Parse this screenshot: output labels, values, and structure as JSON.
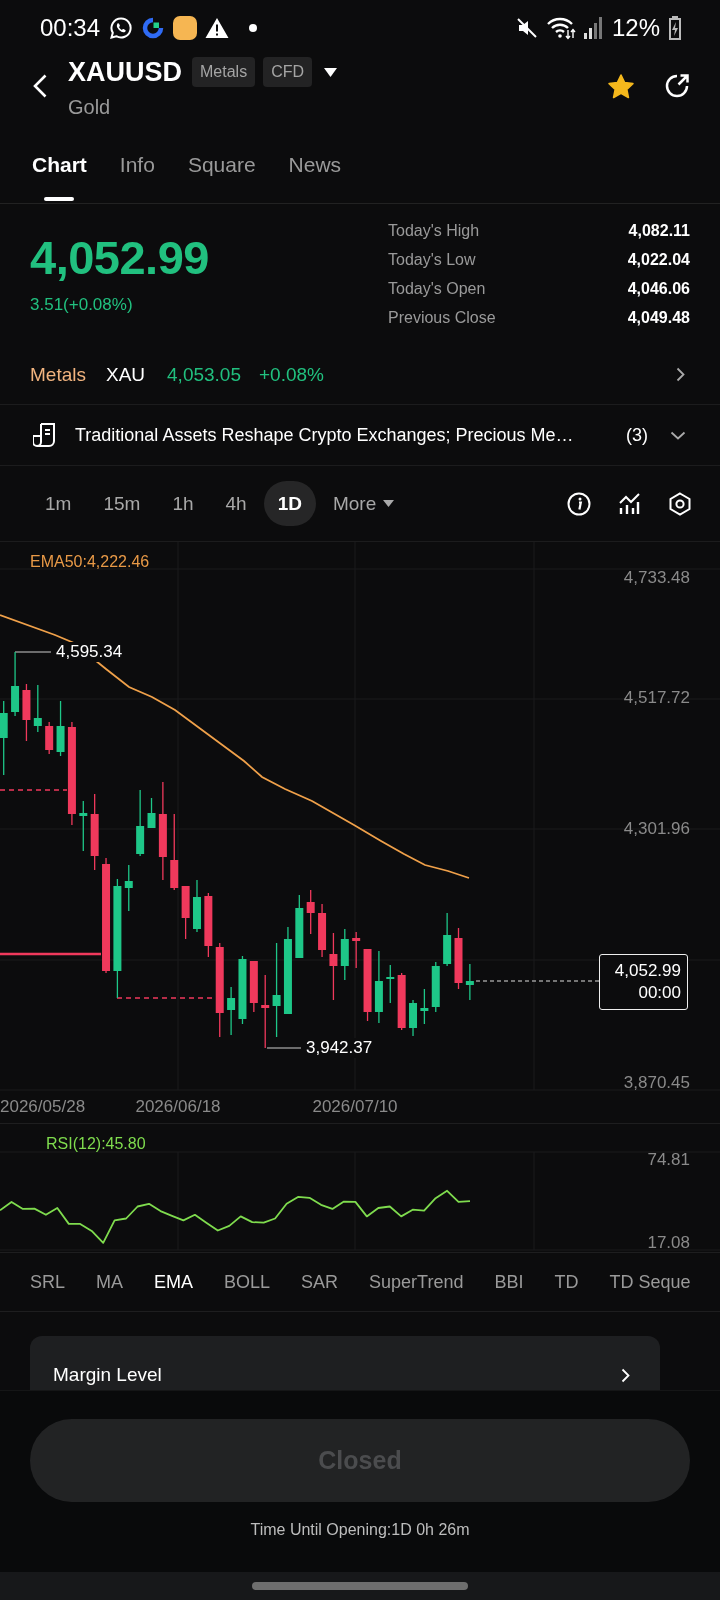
{
  "status_bar": {
    "time": "00:34",
    "battery": "12%"
  },
  "header": {
    "symbol": "XAUUSD",
    "badges": [
      "Metals",
      "CFD"
    ],
    "name": "Gold",
    "favorite": true
  },
  "tabs": [
    {
      "label": "Chart",
      "selected": true
    },
    {
      "label": "Info",
      "selected": false
    },
    {
      "label": "Square",
      "selected": false
    },
    {
      "label": "News",
      "selected": false
    }
  ],
  "quote": {
    "price": "4,052.99",
    "change": "3.51(+0.08%)",
    "stats": [
      {
        "label": "Today's High",
        "value": "4,082.11"
      },
      {
        "label": "Today's Low",
        "value": "4,022.04"
      },
      {
        "label": "Today's Open",
        "value": "4,046.06"
      },
      {
        "label": "Previous Close",
        "value": "4,049.48"
      }
    ]
  },
  "related": {
    "category": "Metals",
    "symbol": "XAU",
    "price": "4,053.05",
    "change": "+0.08%"
  },
  "news": {
    "headline": "Traditional Assets Reshape Crypto Exchanges; Precious Me…",
    "count": "(3)"
  },
  "timeframes": [
    {
      "label": "1m",
      "selected": false
    },
    {
      "label": "15m",
      "selected": false
    },
    {
      "label": "1h",
      "selected": false
    },
    {
      "label": "4h",
      "selected": false
    },
    {
      "label": "1D",
      "selected": true
    }
  ],
  "more": "More",
  "price_chart": {
    "ema_label": "EMA50:4,222.46",
    "axis_labels": [
      "4,733.48",
      "4,517.72",
      "4,301.96",
      "3,870.45"
    ],
    "high_label": "4,595.34",
    "low_label": "3,942.37",
    "last_price": "4,052.99",
    "last_time": "00:00",
    "dates": [
      "2026/05/28",
      "2026/06/18",
      "2026/07/10"
    ]
  },
  "rsi": {
    "legend_value": ":45.80",
    "chart_data": {
      "type": "line",
      "categories": [
        null,
        null,
        null,
        null,
        null,
        null,
        null,
        null,
        null,
        null,
        null,
        null,
        null,
        null,
        null,
        null,
        null,
        null,
        null,
        null,
        null,
        null,
        null,
        null,
        null,
        null,
        null,
        null,
        null,
        null,
        null,
        null,
        null,
        null,
        null,
        null,
        null,
        null,
        null,
        null,
        null,
        null
      ],
      "ylim": [
        11.45,
        80.44
      ],
      "yticks": [
        {
          "value": 74.81,
          "label": "74.81"
        },
        {
          "value": 17.08,
          "label": "17.08"
        }
      ],
      "series": [
        {
          "name": "RSI(12)",
          "color": "#7fdc4e",
          "values": [
            39.4,
            45.3,
            40.4,
            40.6,
            36.2,
            41,
            29.8,
            29.8,
            24.9,
            16.5,
            32.3,
            33.6,
            42.1,
            44,
            38.8,
            35.5,
            32.3,
            36.2,
            30.7,
            25.2,
            28.4,
            35.1,
            31.1,
            30.7,
            33.6,
            44,
            48.8,
            48.2,
            43.3,
            40.4,
            45.5,
            45.3,
            35.1,
            41,
            42.1,
            35.1,
            39.8,
            39.1,
            47.9,
            53.1,
            45.3,
            45.8
          ]
        }
      ]
    }
  },
  "indicators": [
    {
      "label": "SRL",
      "selected": false
    },
    {
      "label": "MA",
      "selected": false
    },
    {
      "label": "EMA",
      "selected": true
    },
    {
      "label": "BOLL",
      "selected": false
    },
    {
      "label": "SAR",
      "selected": false
    },
    {
      "label": "SuperTrend",
      "selected": false
    },
    {
      "label": "BBI",
      "selected": false
    },
    {
      "label": "TD",
      "selected": false
    },
    {
      "label": "TD Seque",
      "selected": false
    }
  ],
  "margin": {
    "label": "Margin Level"
  },
  "action": {
    "label": "Closed",
    "disabled": true
  },
  "countdown": "Time Until Opening:1D 0h 26m"
}
